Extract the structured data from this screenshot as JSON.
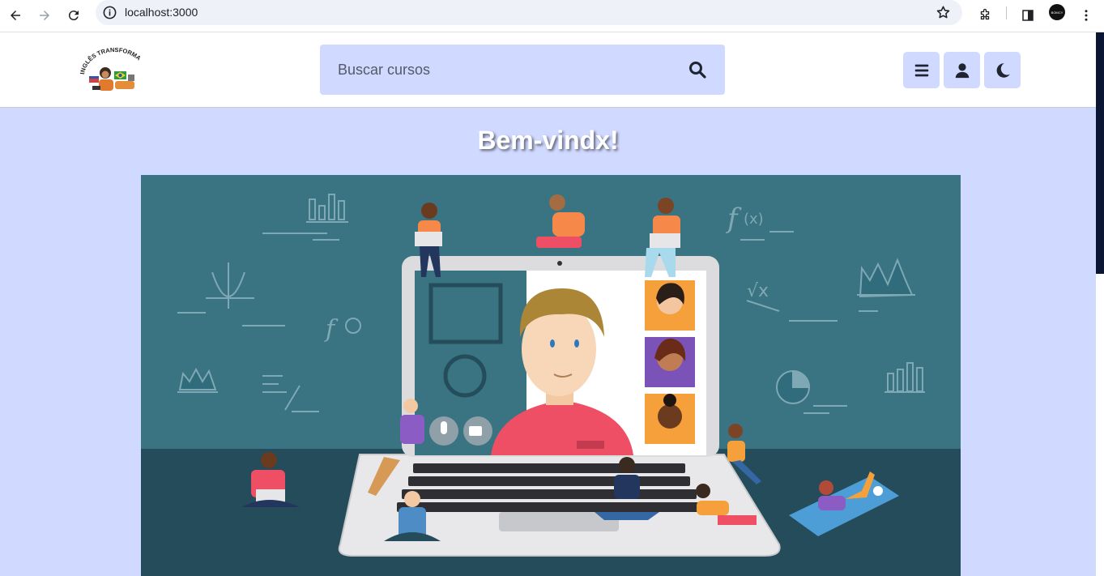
{
  "browser": {
    "url": "localhost:3000",
    "profile_label": "BOMCY"
  },
  "header": {
    "logo_text": "INGLÊS TRANSFORMA",
    "search_placeholder": "Buscar cursos"
  },
  "main": {
    "welcome_title": "Bem-vindx!",
    "hero_alt": "Ilustração de aula online"
  },
  "colors": {
    "accent": "#d0d9ff",
    "hero_bg": "#3a7381",
    "hero_floor": "#244c5a"
  }
}
